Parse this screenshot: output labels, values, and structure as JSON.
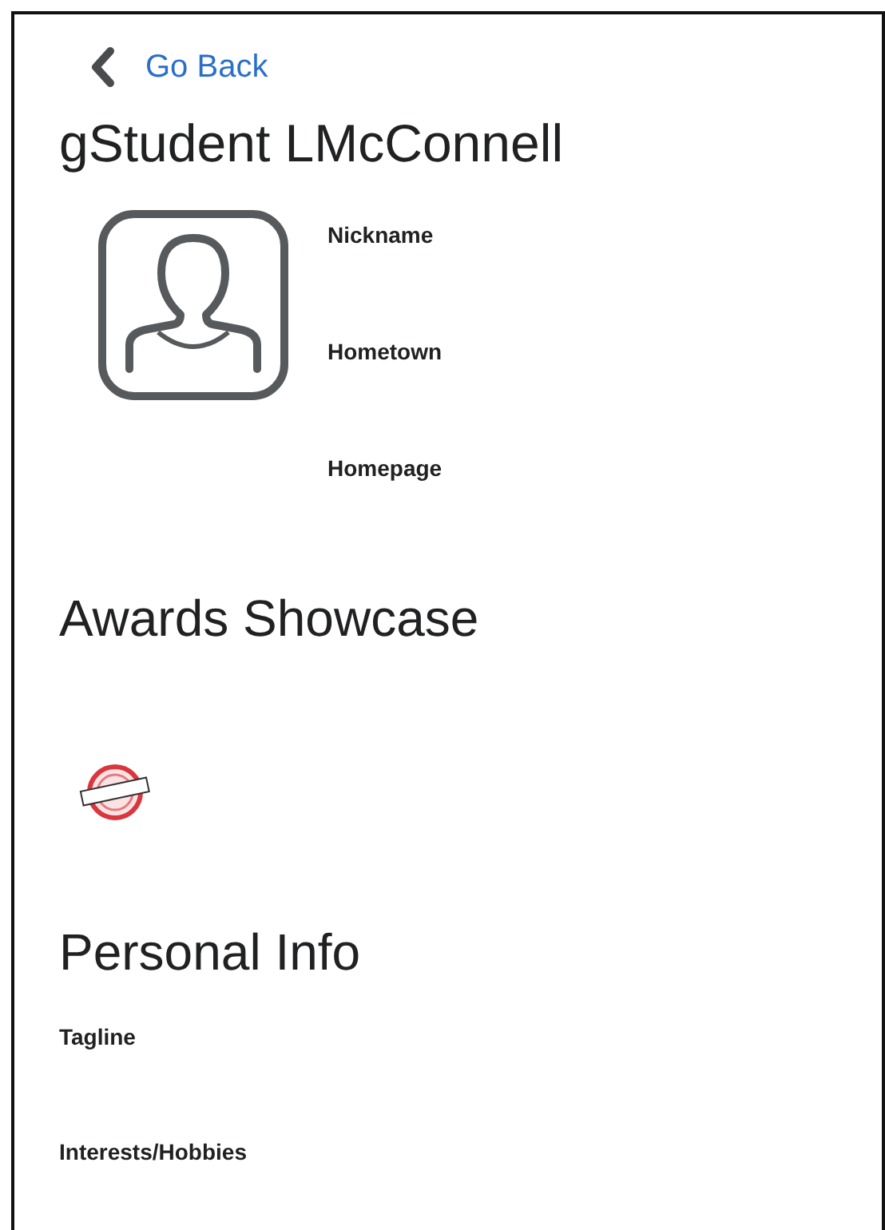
{
  "back_link": {
    "label": "Go Back"
  },
  "title": "gStudent LMcConnell",
  "profile_fields": [
    {
      "label": "Nickname"
    },
    {
      "label": "Hometown"
    },
    {
      "label": "Homepage"
    }
  ],
  "awards": {
    "heading": "Awards Showcase"
  },
  "personal_info": {
    "heading": "Personal Info",
    "fields": [
      {
        "label": "Tagline"
      },
      {
        "label": "Interests/Hobbies"
      }
    ]
  }
}
